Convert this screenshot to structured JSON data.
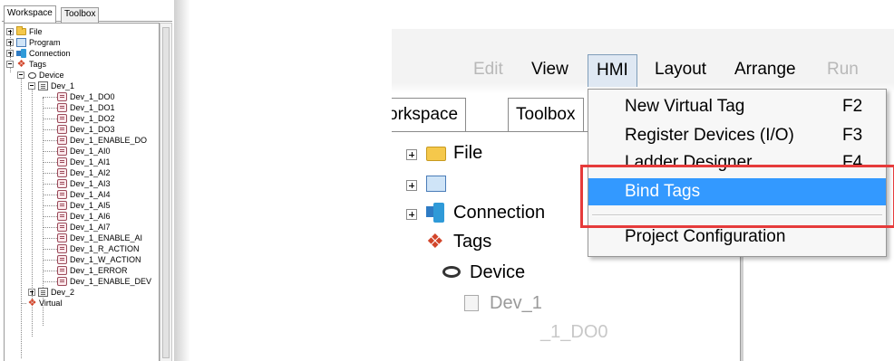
{
  "left_panel": {
    "tabs": [
      "Workspace",
      "Toolbox"
    ],
    "tree": {
      "file": "File",
      "program": "Program",
      "connection": "Connection",
      "tags": "Tags",
      "device": "Device",
      "dev1": "Dev_1",
      "dev1_tags": [
        "Dev_1_DO0",
        "Dev_1_DO1",
        "Dev_1_DO2",
        "Dev_1_DO3",
        "Dev_1_ENABLE_DO",
        "Dev_1_AI0",
        "Dev_1_AI1",
        "Dev_1_AI2",
        "Dev_1_AI3",
        "Dev_1_AI4",
        "Dev_1_AI5",
        "Dev_1_AI6",
        "Dev_1_AI7",
        "Dev_1_ENABLE_AI",
        "Dev_1_R_ACTION",
        "Dev_1_W_ACTION",
        "Dev_1_ERROR",
        "Dev_1_ENABLE_DEV"
      ],
      "dev2": "Dev_2",
      "virtual": "Virtual"
    }
  },
  "zoom": {
    "menubar": {
      "edit": "Edit",
      "view": "View",
      "hmi": "HMI",
      "layout": "Layout",
      "arrange": "Arrange",
      "run": "Run"
    },
    "tabs": {
      "workspace": "orkspace",
      "toolbox": "Toolbox"
    },
    "tree": {
      "file": "File",
      "connection": "Connection",
      "tags": "Tags",
      "device": "Device",
      "dev1": "Dev_1",
      "dev1_do0": "_1_DO0"
    },
    "hmi_menu": {
      "items": [
        {
          "label": "New Virtual Tag",
          "shortcut": "F2"
        },
        {
          "label": "Register Devices (I/O)",
          "shortcut": "F3"
        },
        {
          "label": "Ladder Designer",
          "shortcut": "F4"
        },
        {
          "label": "Bind Tags",
          "shortcut": ""
        },
        {
          "label": "Project Configuration",
          "shortcut": ""
        }
      ],
      "highlighted": "Bind Tags"
    }
  },
  "colors": {
    "highlight": "#3399ff",
    "callout_border": "#e63b3b",
    "arrow_fill": "#4a7db5"
  }
}
